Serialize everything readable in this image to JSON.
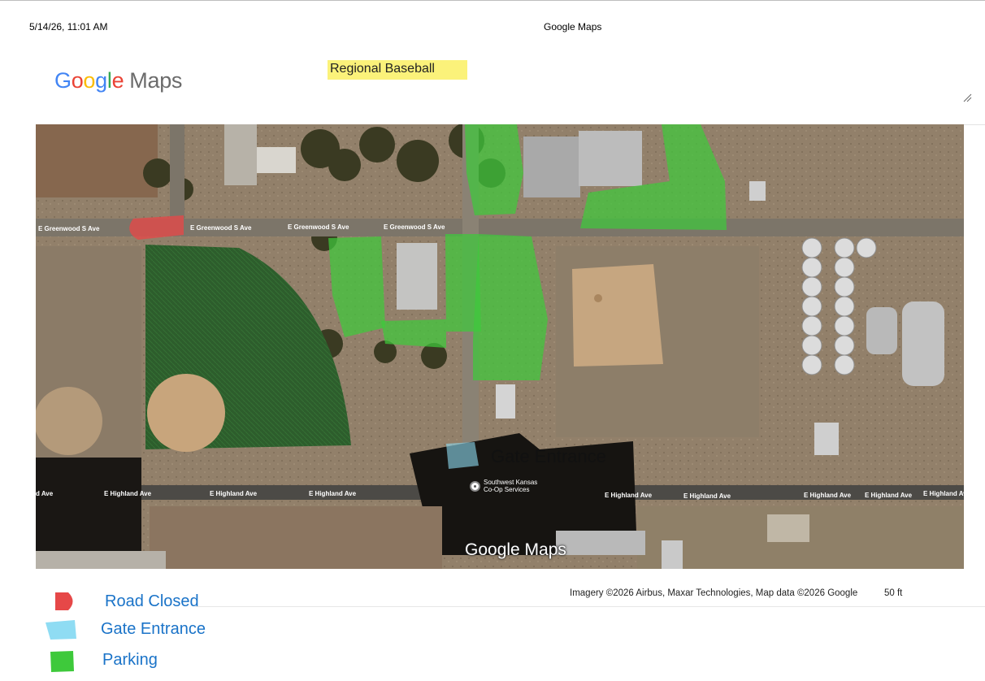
{
  "print_header": {
    "date": "5/14/26, 11:01 AM",
    "title": "Google Maps"
  },
  "logo": {
    "letters": [
      "G",
      "o",
      "o",
      "g",
      "l",
      "e"
    ],
    "product": "Maps"
  },
  "note": {
    "text": "Regional Baseball"
  },
  "map": {
    "streets": {
      "greenwood": "E Greenwood S Ave",
      "highland": "E Highland Ave",
      "highland_cut": "d Ave"
    },
    "overlay_labels": {
      "gate": "Gate Entrance"
    },
    "poi": {
      "line1": "Southwest Kansas",
      "line2": "Co-Op Services"
    },
    "watermark": "Google Maps"
  },
  "footer": {
    "attribution": "Imagery ©2026 Airbus, Maxar Technologies, Map data ©2026 Google",
    "scale": "50 ft"
  },
  "legend": [
    {
      "label": "Road Closed",
      "color": "#e64848"
    },
    {
      "label": "Gate Entrance",
      "color": "#8fdcf3"
    },
    {
      "label": "Parking",
      "color": "#3ec93b"
    }
  ]
}
